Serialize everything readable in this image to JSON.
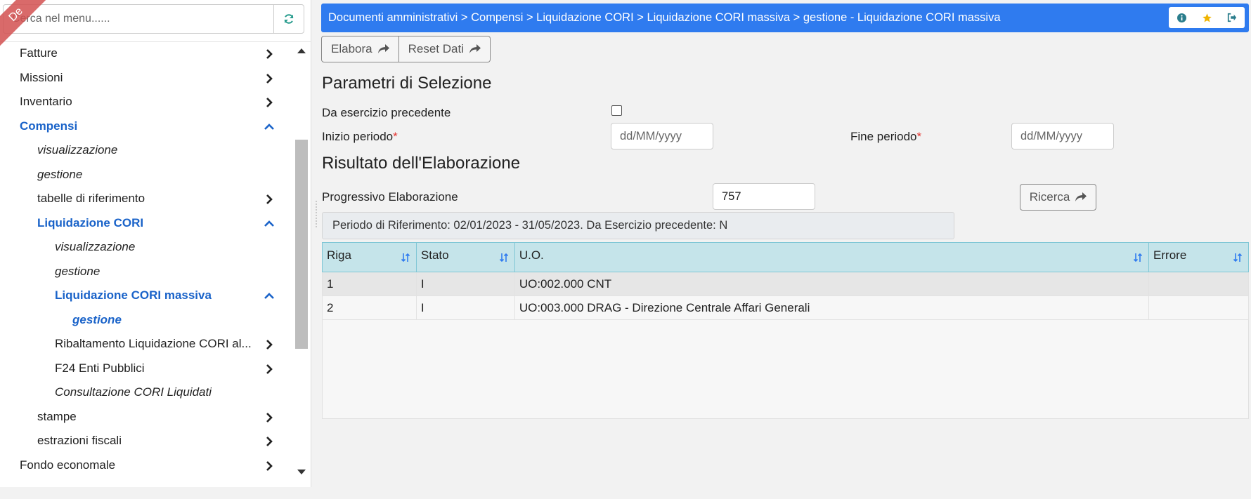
{
  "ribbon": {
    "text": "De"
  },
  "search": {
    "placeholder": "Cerca nel menu......"
  },
  "menu": [
    {
      "label": "Fatture"
    },
    {
      "label": "Missioni"
    },
    {
      "label": "Inventario"
    },
    {
      "label": "Compensi"
    },
    {
      "label": "visualizzazione"
    },
    {
      "label": "gestione"
    },
    {
      "label": "tabelle di riferimento"
    },
    {
      "label": "Liquidazione CORI"
    },
    {
      "label": "visualizzazione"
    },
    {
      "label": "gestione"
    },
    {
      "label": "Liquidazione CORI massiva"
    },
    {
      "label": "gestione"
    },
    {
      "label": "Ribaltamento Liquidazione CORI al..."
    },
    {
      "label": "F24 Enti Pubblici"
    },
    {
      "label": "Consultazione CORI Liquidati"
    },
    {
      "label": "stampe"
    },
    {
      "label": "estrazioni fiscali"
    },
    {
      "label": "Fondo economale"
    }
  ],
  "breadcrumb": "Documenti amministrativi > Compensi > Liquidazione CORI > Liquidazione CORI massiva > gestione - Liquidazione CORI massiva",
  "toolbar": {
    "elabora": "Elabora",
    "reset": "Reset Dati"
  },
  "params": {
    "title": "Parametri di Selezione",
    "da_esercizio_label": "Da esercizio precedente",
    "inizio_label": "Inizio periodo",
    "fine_label": "Fine periodo",
    "required_mark": "*",
    "date_placeholder": "dd/MM/yyyy"
  },
  "result": {
    "title": "Risultato dell'Elaborazione",
    "progressivo_label": "Progressivo Elaborazione",
    "progressivo_value": "757",
    "ricerca": "Ricerca",
    "info": "Periodo di Riferimento: 02/01/2023 - 31/05/2023. Da Esercizio precedente: N"
  },
  "grid": {
    "headers": [
      "Riga",
      "Stato",
      "U.O.",
      "Errore"
    ],
    "rows": [
      [
        "1",
        "I",
        "UO:002.000 CNT",
        ""
      ],
      [
        "2",
        "I",
        "UO:003.000 DRAG - Direzione Centrale Affari Generali",
        ""
      ]
    ]
  },
  "colors": {
    "accent": "#2f7bef",
    "active_menu": "#1a63c9",
    "grid_header": "#c5e4ea",
    "ribbon": "#d25050"
  }
}
